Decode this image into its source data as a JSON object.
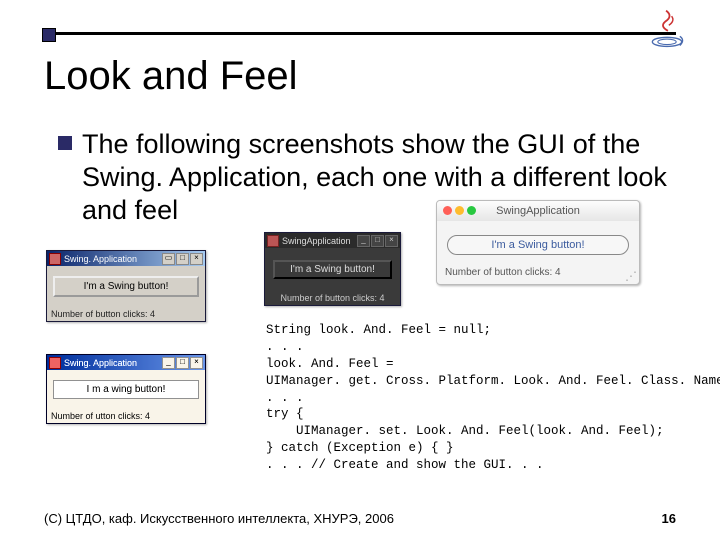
{
  "title": "Look and Feel",
  "bullet": "The following screenshots show the GUI of the Swing. Application, each one with a different look and feel",
  "windows": {
    "win1": {
      "title": "Swing. Application",
      "button": "I'm a Swing button!",
      "status": "Number of button clicks: 4"
    },
    "win2": {
      "title": "Swing. Application",
      "button": "I m a  wing button!",
      "status": "Number of utton clicks: 4"
    },
    "win3": {
      "title": "SwingApplication",
      "button": "I'm a Swing button!",
      "status": "Number of button clicks: 4"
    },
    "win4": {
      "title": "SwingApplication",
      "button": "I'm a Swing button!",
      "status": "Number of button clicks: 4"
    }
  },
  "code": "String look. And. Feel = null;\n. . .\nlook. And. Feel =\nUIManager. get. Cross. Platform. Look. And. Feel. Class. Name();\n. . .\ntry {\n    UIManager. set. Look. And. Feel(look. And. Feel);\n} catch (Exception e) { }\n. . . // Create and show the GUI. . .",
  "footer": {
    "copyright": "(С) ЦТДО, каф. Искусственного интеллекта, ХНУРЭ, 2006",
    "page": "16"
  }
}
